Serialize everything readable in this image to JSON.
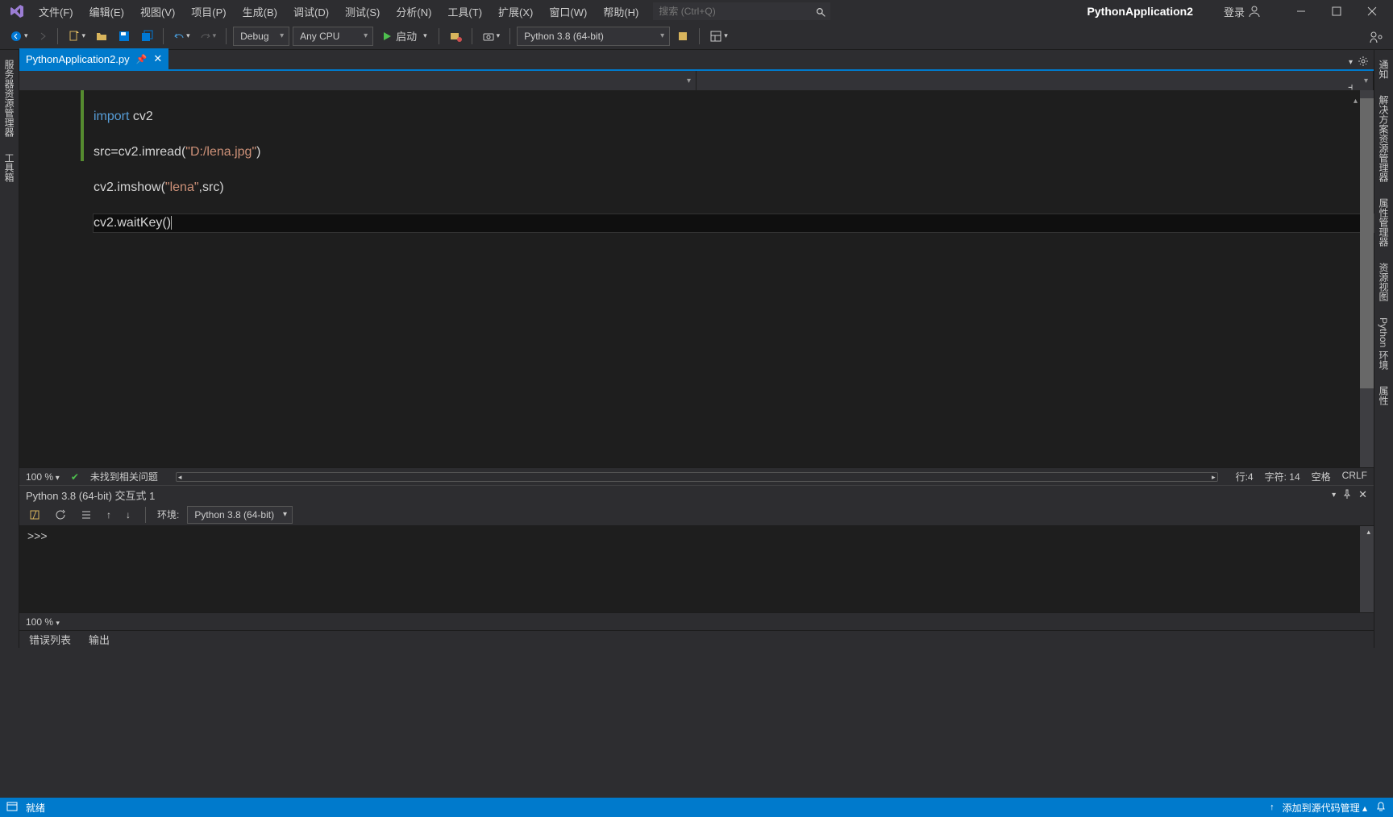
{
  "title": {
    "project": "PythonApplication2",
    "login": "登录"
  },
  "menu": [
    "文件(F)",
    "编辑(E)",
    "视图(V)",
    "项目(P)",
    "生成(B)",
    "调试(D)",
    "测试(S)",
    "分析(N)",
    "工具(T)",
    "扩展(X)",
    "窗口(W)",
    "帮助(H)"
  ],
  "search": {
    "placeholder": "搜索 (Ctrl+Q)"
  },
  "toolbar": {
    "config": "Debug",
    "platform": "Any CPU",
    "start": "启动",
    "python_env": "Python 3.8 (64-bit)"
  },
  "tab": {
    "name": "PythonApplication2.py"
  },
  "code": {
    "lines": [
      {
        "t": "import ",
        "kw": true,
        "rest": "cv2"
      },
      {
        "raw": "src=cv2.imread(\"D:/lena.jpg\")"
      },
      {
        "raw": "cv2.imshow(\"lena\",src)"
      },
      {
        "raw": "cv2.waitKey()",
        "active": true
      }
    ]
  },
  "editor_status": {
    "zoom": "100 %",
    "issues": "未找到相关问题",
    "line": "行:4",
    "col": "字符: 14",
    "ins": "空格",
    "eol": "CRLF"
  },
  "interactive": {
    "title": "Python 3.8 (64-bit) 交互式 1",
    "env_label": "环境:",
    "env": "Python 3.8 (64-bit)",
    "prompt": ">>> ",
    "zoom": "100 %"
  },
  "bottom_tabs": [
    "错误列表",
    "输出"
  ],
  "left_rail": [
    "服务器资源管理器",
    "工具箱"
  ],
  "right_rail": [
    "通知",
    "解决方案资源管理器",
    "属性管理器",
    "资源视图",
    "Python 环境",
    "属性"
  ],
  "statusbar": {
    "ready": "就绪",
    "scm": "添加到源代码管理"
  }
}
